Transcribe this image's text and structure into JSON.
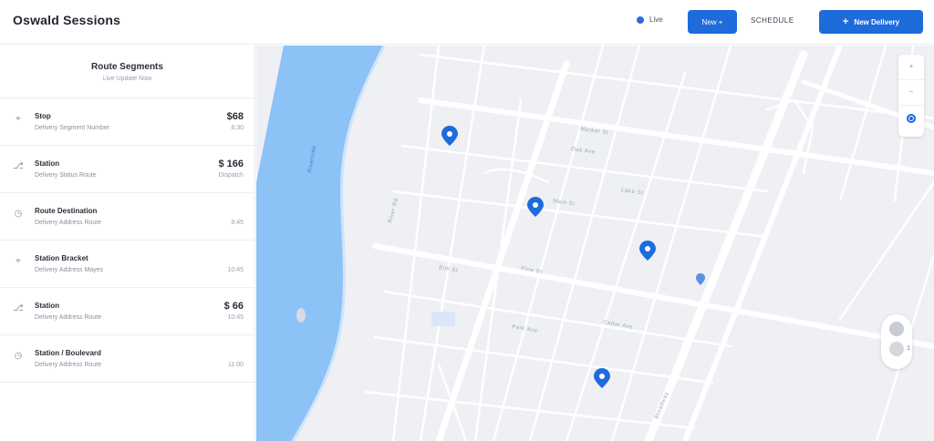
{
  "header": {
    "brand": "Oswald Sessions",
    "status_label": "Live",
    "small_button": "New +",
    "link_label": "SCHEDULE",
    "large_button": "New Delivery",
    "large_button_plus": "+"
  },
  "sidebar": {
    "title": "Route Segments",
    "subtitle": "Live Update Now",
    "items": [
      {
        "icon": "pin-icon",
        "name": "Stop",
        "desc": "Delivery Segment Number",
        "amount": "$68",
        "time": "8:30"
      },
      {
        "icon": "route-icon",
        "name": "Station",
        "desc": "Delivery Status Route",
        "amount": "$ 166",
        "time": "Dispatch"
      },
      {
        "icon": "clock-icon",
        "name": "Route Destination",
        "desc": "Delivery Address Route",
        "amount": "",
        "time": "9:45"
      },
      {
        "icon": "pin-icon",
        "name": "Station Bracket",
        "desc": "Delivery Address Mayes",
        "amount": "",
        "time": "10:45"
      },
      {
        "icon": "route-icon",
        "name": "Station",
        "desc": "Delivery Address Route",
        "amount": "$ 66",
        "time": "10:45"
      },
      {
        "icon": "clock-icon",
        "name": "Station / Boulevard",
        "desc": "Delivery Address Route",
        "amount": "",
        "time": "11:00"
      }
    ]
  },
  "map": {
    "river_label": "Riverside",
    "street_labels": [
      "Market St",
      "Oak Ave",
      "Main St",
      "Elm St",
      "Pine St",
      "Cedar Ave",
      "Park Ave",
      "Lake St",
      "River Rd",
      "Broadway"
    ],
    "controls": [
      "zoom-in",
      "zoom-out",
      "locate"
    ],
    "control_labels": {
      "zoom_in": "+",
      "zoom_out": "−"
    },
    "cluster_count": "1",
    "colors": {
      "water": "#8cc2f5",
      "land": "#eef0f4",
      "road": "#ffffff",
      "accent": "#1e6bdc"
    }
  }
}
